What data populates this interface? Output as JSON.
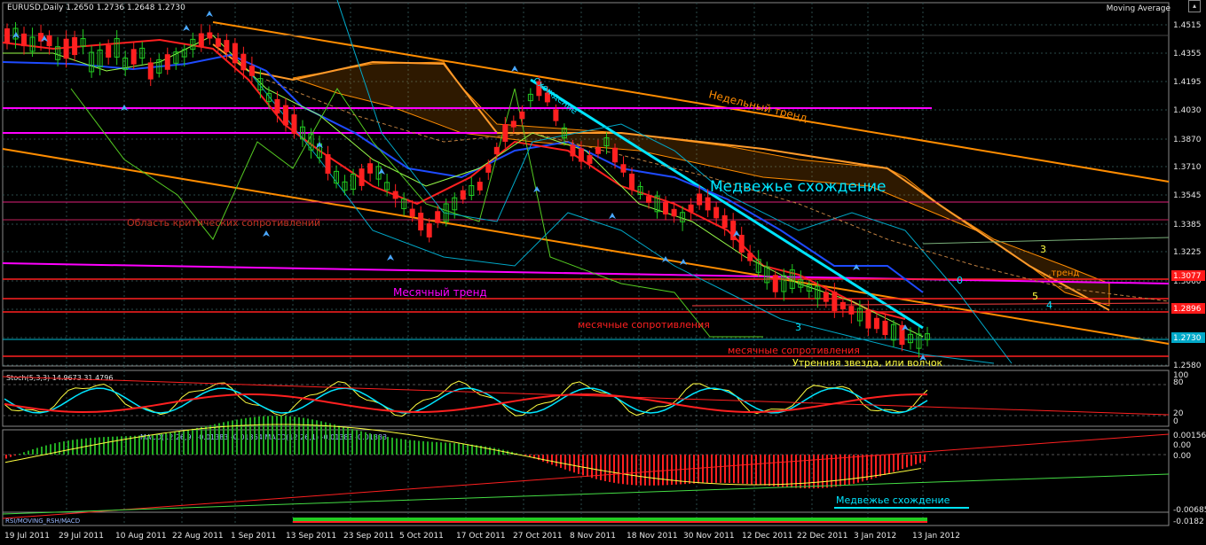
{
  "window": {
    "symbol_line": "EURUSD,Daily  1.2650 1.2736 1.2648 1.2730",
    "indicator_label": "Moving Average"
  },
  "price_axis": {
    "ticks": [
      "1.4515",
      "1.4355",
      "1.4195",
      "1.4030",
      "1.3870",
      "1.3710",
      "1.3545",
      "1.3385",
      "1.3225",
      "1.3060",
      "1.2900",
      "1.2740",
      "1.2580"
    ],
    "tags": [
      {
        "label": "1.3077",
        "color": "#ff1a1a"
      },
      {
        "label": "1.2896",
        "color": "#ff1a1a"
      },
      {
        "label": "1.2730",
        "color": "#00a8c8"
      }
    ]
  },
  "annotations": {
    "weekly_trend": "Недельный тренд",
    "divergence": "Схождение",
    "bear_divergence": "Медвежье схождение",
    "critical_resistance": "Область критических сопротивлений",
    "monthly_trend": "Месячный тренд",
    "monthly_resistance_1": "месячные сопротивления",
    "monthly_resistance_2": "месячные сопротивления",
    "morning_star": "Утренняя звезда, или волчок",
    "partial_trend": "...тренд",
    "wave0": "0",
    "wave3": "3",
    "wave4": "4",
    "wave5": "5",
    "wave3b": "3",
    "macd_bear": "Медвежье схождение"
  },
  "stoch": {
    "label": "Stoch(5,3,3) 14.9673 31.4796",
    "ticks": [
      "100",
      "80",
      "20",
      "0"
    ]
  },
  "macd": {
    "label": "MACD(12,26,9) -0.01383 -0.01364  MACD(12,26,1) -0.01383 -0.01383",
    "ticks": [
      "0.00156",
      "0.00",
      "0.00",
      "-0.00685",
      "-0.0182"
    ]
  },
  "bottom_label": "RSI/MOVING_RSH/MACD",
  "time_axis": [
    "19 Jul 2011",
    "29 Jul 2011",
    "10 Aug 2011",
    "22 Aug 2011",
    "1 Sep 2011",
    "13 Sep 2011",
    "23 Sep 2011",
    "5 Oct 2011",
    "17 Oct 2011",
    "27 Oct 2011",
    "8 Nov 2011",
    "18 Nov 2011",
    "30 Nov 2011",
    "12 Dec 2011",
    "22 Dec 2011",
    "3 Jan 2012",
    "13 Jan 2012"
  ],
  "colors": {
    "bull": "#22cc22",
    "bear": "#ff2020",
    "grid": "#2a4a4a",
    "orange": "#ff8c00",
    "magenta": "#ff00ff",
    "cyan": "#00e5ff",
    "panel_border": "#888888"
  },
  "chart_data": {
    "type": "candlestick",
    "price_range": [
      1.258,
      1.4515
    ],
    "trend": "downtrend",
    "last_close": 1.273
  }
}
